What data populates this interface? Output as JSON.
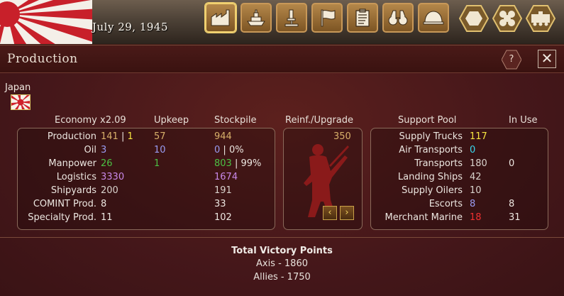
{
  "topbar": {
    "date": "July 29, 1945",
    "buttons": [
      {
        "name": "factory-icon",
        "active": true
      },
      {
        "name": "ship-icon",
        "active": false
      },
      {
        "name": "microscope-icon",
        "active": false
      },
      {
        "name": "flag-icon",
        "active": false
      },
      {
        "name": "clipboard-icon",
        "active": false
      },
      {
        "name": "binoculars-icon",
        "active": false
      },
      {
        "name": "helmet-icon",
        "active": false
      }
    ],
    "hex_buttons": [
      "hex-single-icon",
      "hex-cluster-icon",
      "train-icon"
    ]
  },
  "panel": {
    "title": "Production",
    "help_label": "?",
    "close_label": "✕"
  },
  "nation": {
    "name": "Japan"
  },
  "economy": {
    "headers": {
      "economy": "Economy x2.09",
      "upkeep": "Upkeep",
      "stockpile": "Stockpile"
    },
    "rows": [
      {
        "label": "Production",
        "value": "141",
        "value2": "1",
        "upkeep": "57",
        "stockpile": "944",
        "stockpile_extra": ""
      },
      {
        "label": "Oil",
        "value": "3",
        "value2": "",
        "upkeep": "10",
        "stockpile": "0",
        "stockpile_extra": "0%"
      },
      {
        "label": "Manpower",
        "value": "26",
        "value2": "",
        "upkeep": "1",
        "stockpile": "803",
        "stockpile_extra": "99%"
      },
      {
        "label": "Logistics",
        "value": "3330",
        "value2": "",
        "upkeep": "",
        "stockpile": "1674",
        "stockpile_extra": ""
      },
      {
        "label": "Shipyards",
        "value": "200",
        "value2": "",
        "upkeep": "",
        "stockpile": "191",
        "stockpile_extra": ""
      },
      {
        "label": "COMINT Prod.",
        "value": "8",
        "value2": "",
        "upkeep": "",
        "stockpile": "33",
        "stockpile_extra": ""
      },
      {
        "label": "Specialty Prod.",
        "value": "11",
        "value2": "",
        "upkeep": "",
        "stockpile": "102",
        "stockpile_extra": ""
      }
    ]
  },
  "reinforcement": {
    "header": "Reinf./Upgrade",
    "value": "350",
    "prev_label": "‹",
    "next_label": "›"
  },
  "support": {
    "headers": {
      "pool": "Support Pool",
      "in_use": "In Use"
    },
    "rows": [
      {
        "label": "Supply Trucks",
        "pool": "117",
        "in_use": ""
      },
      {
        "label": "Air Transports",
        "pool": "0",
        "in_use": ""
      },
      {
        "label": "Transports",
        "pool": "180",
        "in_use": "0"
      },
      {
        "label": "Landing Ships",
        "pool": "42",
        "in_use": ""
      },
      {
        "label": "Supply Oilers",
        "pool": "10",
        "in_use": ""
      },
      {
        "label": "Escorts",
        "pool": "8",
        "in_use": "8"
      },
      {
        "label": "Merchant Marine",
        "pool": "18",
        "in_use": "31"
      }
    ]
  },
  "victory": {
    "title": "Total Victory Points",
    "axis": "Axis - 1860",
    "allies": "Allies - 1750"
  },
  "colors": {
    "panel_bg": "#45171a",
    "accent_gold": "#c89858",
    "value_yellow": "#f7e640",
    "value_green": "#4cc044",
    "value_purple": "#c888e8",
    "value_blue": "#9a9cf2",
    "value_cyan": "#38d8f0",
    "value_red": "#f03030"
  }
}
